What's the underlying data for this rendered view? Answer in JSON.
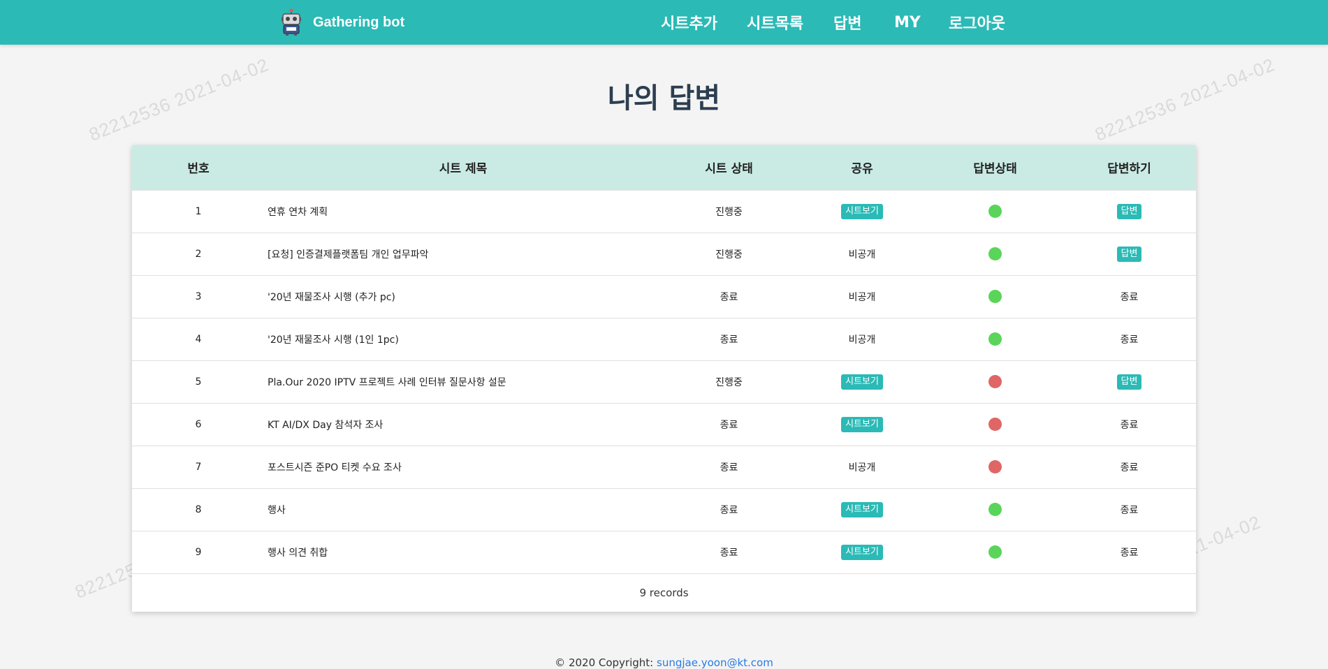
{
  "app": {
    "name": "Gathering bot",
    "nav": [
      "시트추가",
      "시트목록",
      "답변",
      "MY",
      "로그아웃"
    ]
  },
  "page": {
    "title": "나의 답변"
  },
  "table": {
    "columns": [
      "번호",
      "시트 제목",
      "시트 상태",
      "공유",
      "답변상태",
      "답변하기"
    ],
    "rows": [
      {
        "no": "1",
        "title": "연휴 연차 계획",
        "status": "진행중",
        "share": "시트보기",
        "share_link": true,
        "answer_status": "green",
        "action": "답변",
        "action_link": true
      },
      {
        "no": "2",
        "title": "[요청] 인증결제플랫폼팀 개인 업무파악",
        "status": "진행중",
        "share": "비공개",
        "share_link": false,
        "answer_status": "green",
        "action": "답변",
        "action_link": true
      },
      {
        "no": "3",
        "title": "'20년 재물조사 시행 (추가 pc)",
        "status": "종료",
        "share": "비공개",
        "share_link": false,
        "answer_status": "green",
        "action": "종료",
        "action_link": false
      },
      {
        "no": "4",
        "title": "'20년 재물조사 시행 (1인 1pc)",
        "status": "종료",
        "share": "비공개",
        "share_link": false,
        "answer_status": "green",
        "action": "종료",
        "action_link": false
      },
      {
        "no": "5",
        "title": "Pla.Our 2020 IPTV 프로젝트 사례 인터뷰 질문사항 설문",
        "status": "진행중",
        "share": "시트보기",
        "share_link": true,
        "answer_status": "red",
        "action": "답변",
        "action_link": true
      },
      {
        "no": "6",
        "title": "KT AI/DX Day 참석자 조사",
        "status": "종료",
        "share": "시트보기",
        "share_link": true,
        "answer_status": "red",
        "action": "종료",
        "action_link": false
      },
      {
        "no": "7",
        "title": "포스트시즌 준PO 티켓 수요 조사",
        "status": "종료",
        "share": "비공개",
        "share_link": false,
        "answer_status": "red",
        "action": "종료",
        "action_link": false
      },
      {
        "no": "8",
        "title": "행사",
        "status": "종료",
        "share": "시트보기",
        "share_link": true,
        "answer_status": "green",
        "action": "종료",
        "action_link": false
      },
      {
        "no": "9",
        "title": "행사 의견 취합",
        "status": "종료",
        "share": "시트보기",
        "share_link": true,
        "answer_status": "green",
        "action": "종료",
        "action_link": false
      }
    ],
    "footer": "9 records"
  },
  "footer": {
    "copyright": "© 2020 Copyright: ",
    "email": "sungjae.yoon@kt.com"
  },
  "watermark": "82212536  2021-04-02",
  "colors": {
    "primary": "#2bbab6",
    "header_row": "#c9ebe4",
    "status_green": "#5ad55a",
    "status_red": "#e06666",
    "title": "#2c3e50"
  },
  "icons": {
    "logo": "robot-icon"
  }
}
